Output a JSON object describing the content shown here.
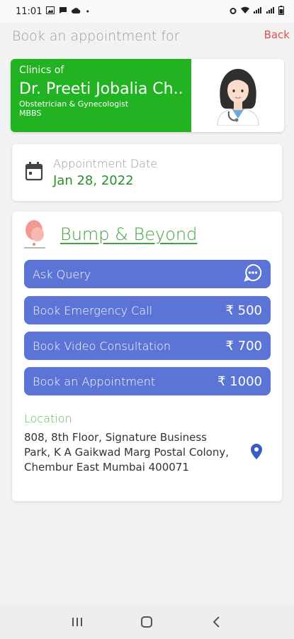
{
  "status_bar": {
    "time": "11:01",
    "dot": "•"
  },
  "header": {
    "title": "Book an appointment for",
    "back_label": "Back"
  },
  "doctor": {
    "clinics_of": "Clinics of",
    "name": "Dr. Preeti Jobalia Ch...",
    "specialization": "Obstetrician & Gynecologist",
    "degree": "MBBS"
  },
  "appointment": {
    "label": "Appointment Date",
    "date": "Jan 28, 2022"
  },
  "clinic": {
    "name": "Bump & Beyond",
    "actions": [
      {
        "label": "Ask Query",
        "price": ""
      },
      {
        "label": "Book Emergency Call",
        "price": "₹ 500"
      },
      {
        "label": "Book Video Consultation",
        "price": "₹ 700"
      },
      {
        "label": "Book an Appointment",
        "price": "₹ 1000"
      }
    ],
    "location_label": "Location",
    "address": "808, 8th Floor, Signature Business Park, K A Gaikwad Marg Postal Colony, Chembur East Mumbai 400071"
  },
  "colors": {
    "doctor_card": "#22b322",
    "action_button": "#5b74d6",
    "back": "#d9534f",
    "clinic_link": "#3fa33f"
  }
}
